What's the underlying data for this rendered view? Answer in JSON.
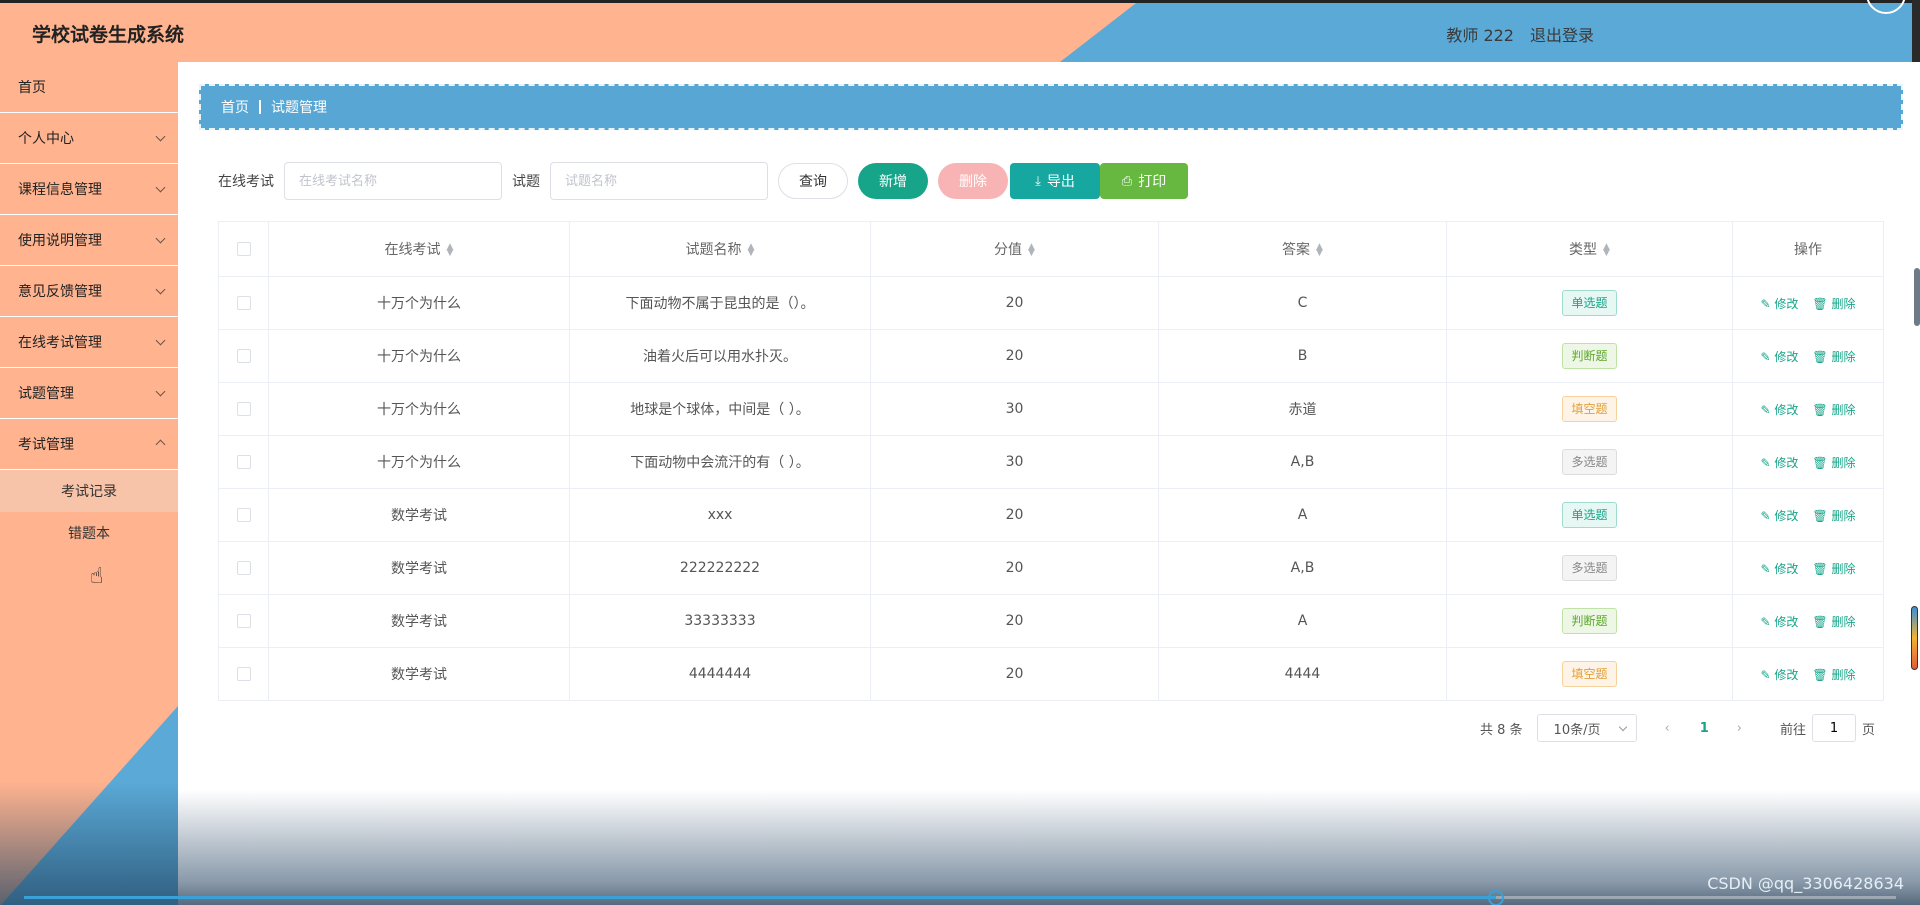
{
  "header": {
    "title": "学校试卷生成系统",
    "user": "教师 222",
    "logout": "退出登录"
  },
  "sidebar": {
    "items": [
      {
        "label": "首页",
        "hasArrow": false
      },
      {
        "label": "个人中心",
        "hasArrow": true
      },
      {
        "label": "课程信息管理",
        "hasArrow": true
      },
      {
        "label": "使用说明管理",
        "hasArrow": true
      },
      {
        "label": "意见反馈管理",
        "hasArrow": true
      },
      {
        "label": "在线考试管理",
        "hasArrow": true
      },
      {
        "label": "试题管理",
        "hasArrow": true
      },
      {
        "label": "考试管理",
        "hasArrow": true,
        "open": true
      }
    ],
    "subitems": [
      {
        "label": "考试记录",
        "active": true
      },
      {
        "label": "错题本"
      }
    ]
  },
  "breadcrumb": {
    "home": "首页",
    "current": "试题管理"
  },
  "search": {
    "exam_label": "在线考试",
    "exam_placeholder": "在线考试名称",
    "question_label": "试题",
    "question_placeholder": "试题名称",
    "query": "查询",
    "add": "新增",
    "delete": "删除",
    "export": "导出",
    "print": "打印"
  },
  "table": {
    "headers": {
      "exam": "在线考试",
      "name": "试题名称",
      "score": "分值",
      "answer": "答案",
      "type": "类型",
      "ops": "操作"
    },
    "edit_label": "修改",
    "delete_label": "删除",
    "rows": [
      {
        "exam": "十万个为什么",
        "name": "下面动物不属于昆虫的是（）。",
        "score": "20",
        "answer": "C",
        "type": "单选题"
      },
      {
        "exam": "十万个为什么",
        "name": "油着火后可以用水扑灭。",
        "score": "20",
        "answer": "B",
        "type": "判断题"
      },
      {
        "exam": "十万个为什么",
        "name": "地球是个球体，中间是（ ）。",
        "score": "30",
        "answer": "赤道",
        "type": "填空题"
      },
      {
        "exam": "十万个为什么",
        "name": "下面动物中会流汗的有（ ）。",
        "score": "30",
        "answer": "A,B",
        "type": "多选题"
      },
      {
        "exam": "数学考试",
        "name": "xxx",
        "score": "20",
        "answer": "A",
        "type": "单选题"
      },
      {
        "exam": "数学考试",
        "name": "222222222",
        "score": "20",
        "answer": "A,B",
        "type": "多选题"
      },
      {
        "exam": "数学考试",
        "name": "33333333",
        "score": "20",
        "answer": "A",
        "type": "判断题"
      },
      {
        "exam": "数学考试",
        "name": "4444444",
        "score": "20",
        "answer": "4444",
        "type": "填空题"
      }
    ]
  },
  "type_colors": {
    "单选题": {
      "bg": "#e6f7f4",
      "border": "#9fdccf",
      "color": "#17a589"
    },
    "判断题": {
      "bg": "#eef7e6",
      "border": "#bfe3a6",
      "color": "#5ca82c"
    },
    "填空题": {
      "bg": "#fdf3e6",
      "border": "#f5d29b",
      "color": "#e2a03a"
    },
    "多选题": {
      "bg": "#f4f4f5",
      "border": "#dcdcdf",
      "color": "#888"
    }
  },
  "pager": {
    "total": "共 8 条",
    "size": "10条/页",
    "current": "1",
    "goto_prefix": "前往",
    "goto_value": "1",
    "goto_suffix": "页"
  },
  "watermark": "CSDN @qq_3306428634"
}
